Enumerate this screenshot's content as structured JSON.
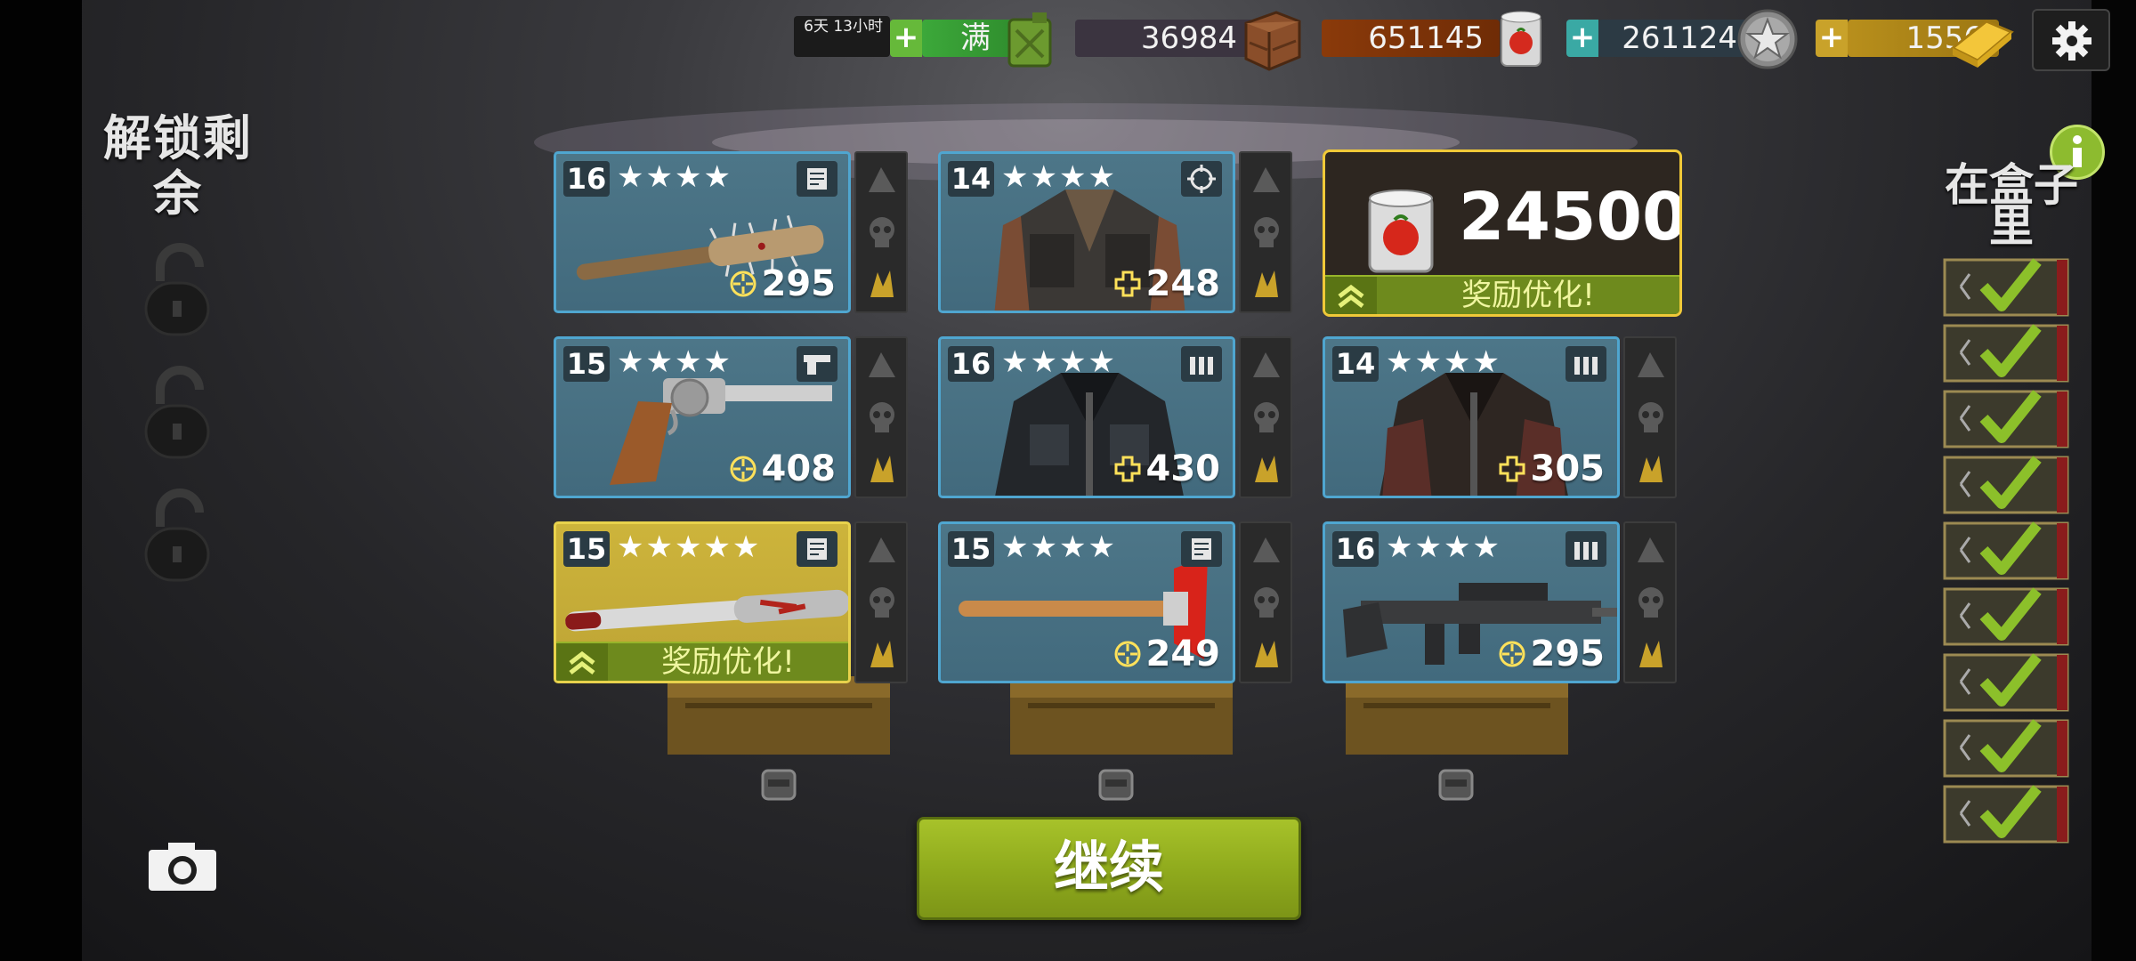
{
  "top_bar": {
    "timer": "6天 13小时",
    "fuel_label": "满",
    "crates_value": "36984",
    "cans_value": "651145",
    "badges_value": "261124",
    "gold_value": "1556"
  },
  "left_panel": {
    "unlock_title": "解锁剩余"
  },
  "right_panel": {
    "inbox_title": "在盒子里",
    "checked_count": 9
  },
  "cards": [
    {
      "level": "16",
      "stars": "★★★★",
      "power": "295",
      "type_icon": "melee-icon",
      "item": "spiked-bat",
      "power_icon": "crosshair"
    },
    {
      "level": "14",
      "stars": "★★★★",
      "power": "248",
      "type_icon": "crosshair-icon",
      "item": "vest-jacket",
      "power_icon": "cross"
    },
    {
      "level": "15",
      "stars": "★★★★",
      "power": "408",
      "type_icon": "pistol-icon",
      "item": "revolver",
      "power_icon": "crosshair"
    },
    {
      "level": "16",
      "stars": "★★★★",
      "power": "430",
      "type_icon": "ammo-icon",
      "item": "tactical-jacket",
      "power_icon": "cross"
    },
    {
      "level": "14",
      "stars": "★★★★",
      "power": "305",
      "type_icon": "ammo-icon",
      "item": "armored-jacket",
      "power_icon": "cross"
    },
    {
      "level": "15",
      "stars": "★★★★★",
      "power": "",
      "type_icon": "melee-icon",
      "item": "bloody-bat",
      "power_icon": "crosshair"
    },
    {
      "level": "15",
      "stars": "★★★★",
      "power": "249",
      "type_icon": "melee-icon",
      "item": "fire-axe",
      "power_icon": "crosshair"
    },
    {
      "level": "16",
      "stars": "★★★★",
      "power": "295",
      "type_icon": "ammo-icon",
      "item": "assault-rifle",
      "power_icon": "crosshair"
    }
  ],
  "reward": {
    "amount": "24500",
    "bonus_label": "奖励优化!"
  },
  "gold_card_bonus_label": "奖励优化!",
  "continue_label": "继续",
  "colors": {
    "card_blue": "#4d7688",
    "card_border": "#4fa6d0",
    "gold": "#cdb43b",
    "green_button": "#8ea91c",
    "reward_border": "#f0c938"
  }
}
